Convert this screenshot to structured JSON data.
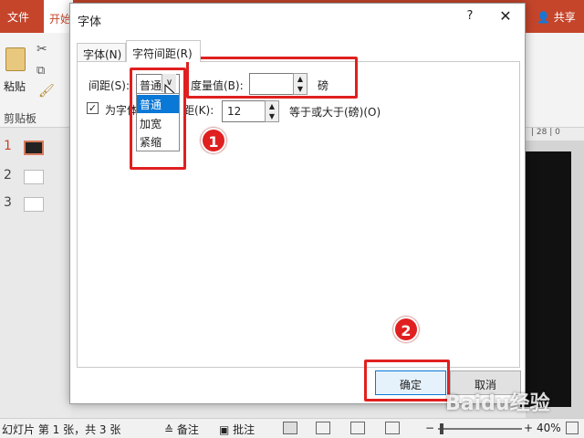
{
  "app": {
    "tabs": {
      "file": "文件",
      "home": "开始"
    },
    "share": "共享",
    "clipboard": {
      "paste": "粘贴",
      "group_label": "剪贴板"
    },
    "slides": [
      {
        "num": "1"
      },
      {
        "num": "2"
      },
      {
        "num": "3"
      }
    ],
    "ruler_text": "| 28 | 0",
    "status": {
      "slide_info": "幻灯片 第 1 张，共 3 张",
      "notes": "备注",
      "comments": "批注",
      "zoom_minus": "−",
      "zoom_plus": "+",
      "zoom_level": "40%"
    }
  },
  "dialog": {
    "title": "字体",
    "help": "?",
    "close": "✕",
    "tabs": {
      "font": "字体(N)",
      "spacing": "字符间距(R)"
    },
    "spacing": {
      "label": "间距(S):",
      "selected": "普通",
      "options": [
        "普通",
        "加宽",
        "紧缩"
      ]
    },
    "measure": {
      "label": "度量值(B):",
      "value": "",
      "unit": "磅"
    },
    "kerning": {
      "checked": true,
      "label_visible": "为字体",
      "label_tail": "距(K):",
      "value": "12",
      "after": "等于或大于(磅)(O)"
    },
    "buttons": {
      "ok": "确定",
      "cancel": "取消"
    }
  },
  "annotations": {
    "color": "#e02020",
    "badges": [
      "1",
      "2"
    ]
  },
  "watermark": "Baidu经验",
  "colors": {
    "ribbon": "#c5452b",
    "accent": "#0a78d7"
  }
}
